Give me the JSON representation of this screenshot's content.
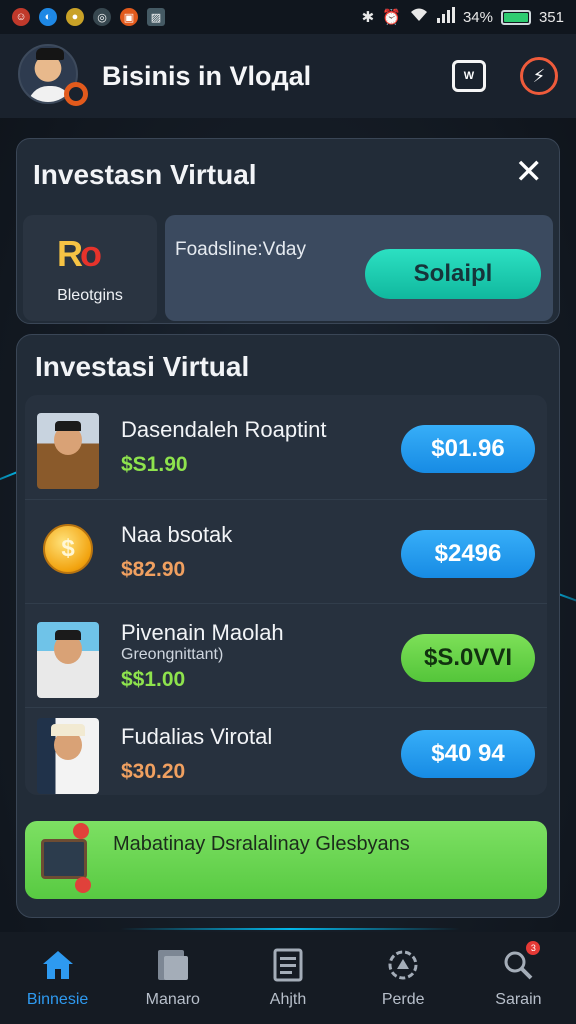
{
  "status_bar": {
    "battery_percent": "34%",
    "time": "351",
    "app_icons": [
      "jollibee-icon",
      "app-blue-icon",
      "coin-icon",
      "camera-icon",
      "gallery-icon",
      "chart-icon"
    ]
  },
  "header": {
    "title": "Bisinis in Vloдal"
  },
  "promo": {
    "title": "Investasn Virtual",
    "tile_label": "Bleotgins",
    "tile_logo": "R",
    "panel_text": "Foadsline:Vday",
    "cta_label": "Solaipl"
  },
  "main": {
    "title": "Investasi Virtual",
    "items": [
      {
        "name": "Dasendaleh Roaptint",
        "amount": "$S1.90",
        "amount_color": "#8ee34d",
        "button": "$01.96",
        "button_style": "blue"
      },
      {
        "name": "Naa bsotak",
        "amount": "$82.90",
        "amount_color": "#f0a060",
        "button": "$2496",
        "button_style": "blue"
      },
      {
        "name": "Pivenain Maolah",
        "sub": "Greongnittant)",
        "amount": "$$1.00",
        "amount_color": "#8ee34d",
        "button": "$S.0VVI",
        "button_style": "green"
      },
      {
        "name": "Fudalias Virotal",
        "amount": "$30.20",
        "amount_color": "#f0a060",
        "button": "$40 94",
        "button_style": "blue"
      }
    ],
    "banner_text": "Mabatinay Dsralalinay Glesbyans"
  },
  "bottom_nav": [
    {
      "label": "Binnesie",
      "icon": "home-icon",
      "active": true
    },
    {
      "label": "Manaro",
      "icon": "folder-icon",
      "active": false
    },
    {
      "label": "Ahjth",
      "icon": "document-icon",
      "active": false
    },
    {
      "label": "Perde",
      "icon": "settings-icon",
      "active": false
    },
    {
      "label": "Sarain",
      "icon": "profile-search-icon",
      "active": false,
      "badge": "3"
    }
  ],
  "colors": {
    "accent_blue": "#2e9af0",
    "accent_green": "#58ca42",
    "accent_teal": "#1fcfb0",
    "card_bg": "#222c38"
  }
}
